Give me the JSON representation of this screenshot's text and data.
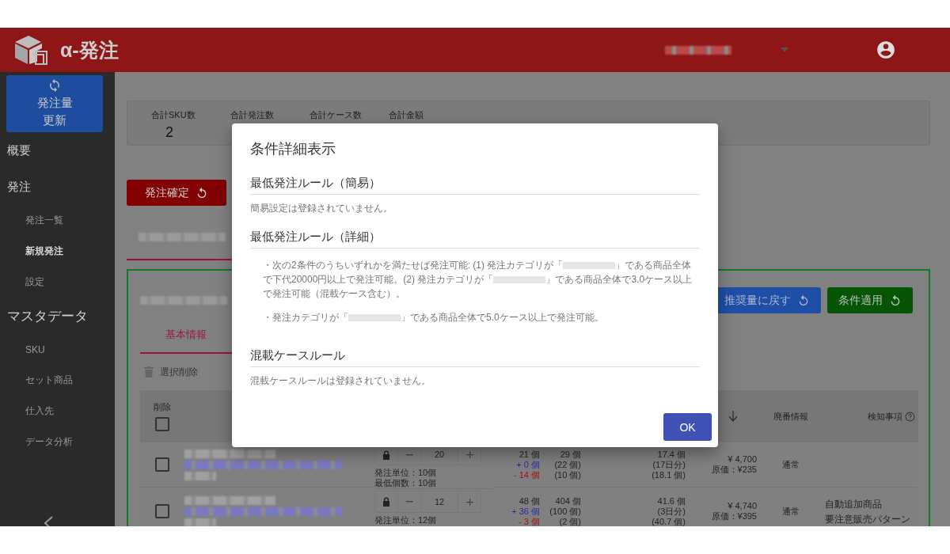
{
  "header": {
    "app_name": "α-発注"
  },
  "sidebar": {
    "update_button": "発注量更新",
    "nav": [
      {
        "label": "概要"
      },
      {
        "label": "発注",
        "children": [
          {
            "label": "発注一覧",
            "selected": false
          },
          {
            "label": "新規発注",
            "selected": true
          },
          {
            "label": "設定",
            "selected": false
          }
        ]
      },
      {
        "label": "マスタデータ",
        "children": [
          {
            "label": "SKU",
            "selected": false
          },
          {
            "label": "セット商品",
            "selected": false
          },
          {
            "label": "仕入先",
            "selected": false
          },
          {
            "label": "データ分析",
            "selected": false
          }
        ]
      }
    ]
  },
  "summary": [
    {
      "label": "合計SKU数",
      "value": "2"
    },
    {
      "label": "合計発注数"
    },
    {
      "label": "合計ケース数"
    },
    {
      "label": "合計金額"
    }
  ],
  "confirm_button": "発注確定",
  "panel": {
    "buttons": [
      {
        "label": "推奨量に戻す",
        "kind": "reset"
      },
      {
        "label": "条件適用",
        "kind": "apply"
      }
    ],
    "tabs": [
      {
        "label": "基本情報",
        "selected": true
      }
    ],
    "delete_selected": "選択削除"
  },
  "table": {
    "header": {
      "delete_label": "削除",
      "checked": false,
      "column_8": "廃番情報",
      "column_9": "検知事項"
    },
    "rows": [
      {
        "checked": false,
        "quantity": "20",
        "unit": "発注単位：10個",
        "minimum": "最低個数：10個",
        "column_4": [
          {
            "text": "21 個",
            "kind": "plain"
          },
          {
            "text": "+ 0 個",
            "kind": "plus"
          },
          {
            "text": "- 14 個",
            "kind": "minus"
          }
        ],
        "column_5": [
          "29 個",
          "(22 個)",
          "(10 個)"
        ],
        "column_6": [
          "17.4 個",
          "(17日分)",
          "(18.1 個)"
        ],
        "price": "¥ 4,700",
        "cost": "原価：¥235",
        "status": "通常"
      },
      {
        "checked": false,
        "quantity": "12",
        "unit": "発注単位：12個",
        "column_4": [
          {
            "text": "48 個",
            "kind": "plain"
          },
          {
            "text": "+ 36 個",
            "kind": "plus"
          },
          {
            "text": "- 3 個",
            "kind": "minus"
          }
        ],
        "column_5": [
          "404 個",
          "(100 個)",
          "(2 個)"
        ],
        "column_6": [
          "41.6 個",
          "(3日分)",
          "(40.7 個)"
        ],
        "price": "¥ 4,740",
        "cost": "原価：¥395",
        "status": "通常",
        "notes": [
          "自動追加商品",
          "要注意販売パターン"
        ]
      }
    ]
  },
  "dialog": {
    "title": "条件詳細表示",
    "sections": [
      {
        "heading": "最低発注ルール（簡易）",
        "body": [
          {
            "parts": [
              {
                "text": "簡易設定は登録されていません。"
              }
            ]
          }
        ]
      },
      {
        "heading": "最低発注ルール（詳細）",
        "bullets": true,
        "body": [
          {
            "parts": [
              {
                "text": "・次の2条件のうちいずれかを満たせば発注可能: (1) 発注カテゴリが「"
              },
              {
                "kind": "redacted"
              },
              {
                "text": "」である商品全体で下代20000円以上で発注可能。(2) 発注カテゴリが「"
              },
              {
                "kind": "redacted"
              },
              {
                "text": "」である商品全体で3.0ケース以上で発注可能（混載ケース含む）。"
              }
            ]
          },
          {
            "parts": [
              {
                "text": "・発注カテゴリが「"
              },
              {
                "kind": "redacted"
              },
              {
                "text": "」である商品全体で5.0ケース以上で発注可能。"
              }
            ]
          }
        ]
      },
      {
        "heading": "混載ケースルール",
        "body": [
          {
            "parts": [
              {
                "text": "混載ケースルールは登録されていません。"
              }
            ]
          }
        ]
      }
    ],
    "ok_button": "OK"
  }
}
